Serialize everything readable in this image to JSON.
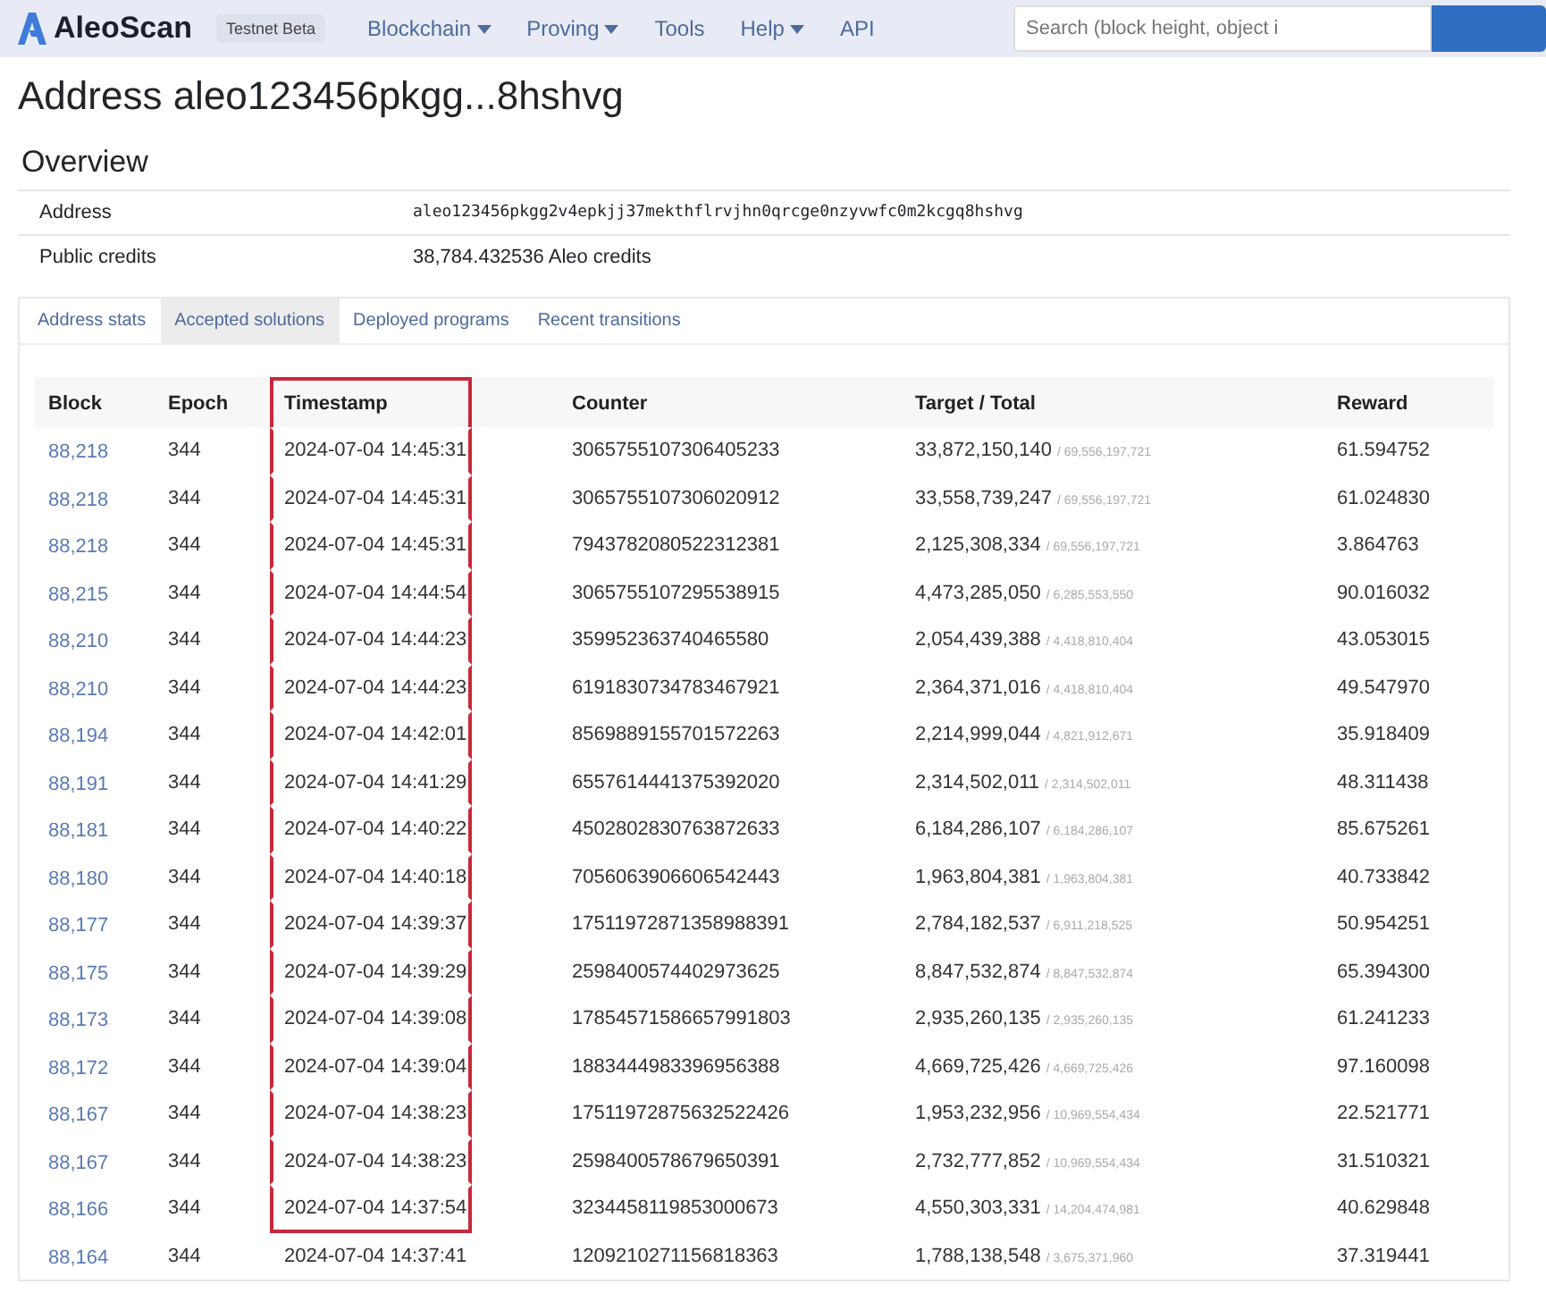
{
  "navbar": {
    "brand": "AleoScan",
    "badge": "Testnet Beta",
    "items": [
      {
        "label": "Blockchain",
        "has_menu": true
      },
      {
        "label": "Proving",
        "has_menu": true
      },
      {
        "label": "Tools",
        "has_menu": false
      },
      {
        "label": "Help",
        "has_menu": true
      },
      {
        "label": "API",
        "has_menu": false
      }
    ],
    "search": {
      "placeholder": "Search (block height, object i"
    }
  },
  "title": "Address aleo123456pkgg...8hshvg",
  "overview": {
    "heading": "Overview",
    "rows": [
      {
        "kind": "mono",
        "label": "Address",
        "value": "aleo123456pkgg2v4epkjj37mekthflrvjhn0qrcge0nzyvwfc0m2kcgq8hshvg"
      },
      {
        "kind": "text",
        "label": "Public credits",
        "value": "38,784.432536 Aleo credits"
      }
    ]
  },
  "tabs": [
    {
      "label": "Address stats",
      "selected": false
    },
    {
      "label": "Accepted solutions",
      "selected": true
    },
    {
      "label": "Deployed programs",
      "selected": false
    },
    {
      "label": "Recent transitions",
      "selected": false
    }
  ],
  "table": {
    "columns": [
      {
        "label": "Block",
        "highlighted": false
      },
      {
        "label": "Epoch",
        "highlighted": false
      },
      {
        "label": "Timestamp",
        "highlighted": true
      },
      {
        "label": "Counter",
        "highlighted": false
      },
      {
        "label": "Target / Total",
        "highlighted": false
      },
      {
        "label": "Reward",
        "highlighted": false
      }
    ],
    "rows": [
      {
        "block": "88,218",
        "epoch": "344",
        "timestamp": "2024-07-04 14:45:31",
        "counter": "3065755107306405233",
        "target": "33,872,150,140",
        "total": "/ 69,556,197,721",
        "reward": "61.594752",
        "highlighted": true
      },
      {
        "block": "88,218",
        "epoch": "344",
        "timestamp": "2024-07-04 14:45:31",
        "counter": "3065755107306020912",
        "target": "33,558,739,247",
        "total": "/ 69,556,197,721",
        "reward": "61.024830",
        "highlighted": true
      },
      {
        "block": "88,218",
        "epoch": "344",
        "timestamp": "2024-07-04 14:45:31",
        "counter": "7943782080522312381",
        "target": "2,125,308,334",
        "total": "/ 69,556,197,721",
        "reward": "3.864763",
        "highlighted": true
      },
      {
        "block": "88,215",
        "epoch": "344",
        "timestamp": "2024-07-04 14:44:54",
        "counter": "3065755107295538915",
        "target": "4,473,285,050",
        "total": "/ 6,285,553,550",
        "reward": "90.016032",
        "highlighted": true
      },
      {
        "block": "88,210",
        "epoch": "344",
        "timestamp": "2024-07-04 14:44:23",
        "counter": "359952363740465580",
        "target": "2,054,439,388",
        "total": "/ 4,418,810,404",
        "reward": "43.053015",
        "highlighted": true
      },
      {
        "block": "88,210",
        "epoch": "344",
        "timestamp": "2024-07-04 14:44:23",
        "counter": "6191830734783467921",
        "target": "2,364,371,016",
        "total": "/ 4,418,810,404",
        "reward": "49.547970",
        "highlighted": true
      },
      {
        "block": "88,194",
        "epoch": "344",
        "timestamp": "2024-07-04 14:42:01",
        "counter": "8569889155701572263",
        "target": "2,214,999,044",
        "total": "/ 4,821,912,671",
        "reward": "35.918409",
        "highlighted": true
      },
      {
        "block": "88,191",
        "epoch": "344",
        "timestamp": "2024-07-04 14:41:29",
        "counter": "6557614441375392020",
        "target": "2,314,502,011",
        "total": "/ 2,314,502,011",
        "reward": "48.311438",
        "highlighted": true
      },
      {
        "block": "88,181",
        "epoch": "344",
        "timestamp": "2024-07-04 14:40:22",
        "counter": "4502802830763872633",
        "target": "6,184,286,107",
        "total": "/ 6,184,286,107",
        "reward": "85.675261",
        "highlighted": true
      },
      {
        "block": "88,180",
        "epoch": "344",
        "timestamp": "2024-07-04 14:40:18",
        "counter": "7056063906606542443",
        "target": "1,963,804,381",
        "total": "/ 1,963,804,381",
        "reward": "40.733842",
        "highlighted": true
      },
      {
        "block": "88,177",
        "epoch": "344",
        "timestamp": "2024-07-04 14:39:37",
        "counter": "17511972871358988391",
        "target": "2,784,182,537",
        "total": "/ 6,911,218,525",
        "reward": "50.954251",
        "highlighted": true
      },
      {
        "block": "88,175",
        "epoch": "344",
        "timestamp": "2024-07-04 14:39:29",
        "counter": "2598400574402973625",
        "target": "8,847,532,874",
        "total": "/ 8,847,532,874",
        "reward": "65.394300",
        "highlighted": true
      },
      {
        "block": "88,173",
        "epoch": "344",
        "timestamp": "2024-07-04 14:39:08",
        "counter": "17854571586657991803",
        "target": "2,935,260,135",
        "total": "/ 2,935,260,135",
        "reward": "61.241233",
        "highlighted": true
      },
      {
        "block": "88,172",
        "epoch": "344",
        "timestamp": "2024-07-04 14:39:04",
        "counter": "1883444983396956388",
        "target": "4,669,725,426",
        "total": "/ 4,669,725,426",
        "reward": "97.160098",
        "highlighted": true
      },
      {
        "block": "88,167",
        "epoch": "344",
        "timestamp": "2024-07-04 14:38:23",
        "counter": "17511972875632522426",
        "target": "1,953,232,956",
        "total": "/ 10,969,554,434",
        "reward": "22.521771",
        "highlighted": true
      },
      {
        "block": "88,167",
        "epoch": "344",
        "timestamp": "2024-07-04 14:38:23",
        "counter": "2598400578679650391",
        "target": "2,732,777,852",
        "total": "/ 10,969,554,434",
        "reward": "31.510321",
        "highlighted": true
      },
      {
        "block": "88,166",
        "epoch": "344",
        "timestamp": "2024-07-04 14:37:54",
        "counter": "3234458119853000673",
        "target": "4,550,303,331",
        "total": "/ 14,204,474,981",
        "reward": "40.629848",
        "highlighted": true
      },
      {
        "block": "88,164",
        "epoch": "344",
        "timestamp": "2024-07-04 14:37:41",
        "counter": "1209210271156818363",
        "target": "1,788,138,548",
        "total": "/ 3,675,371,960",
        "reward": "37.319441",
        "highlighted": false
      }
    ]
  }
}
